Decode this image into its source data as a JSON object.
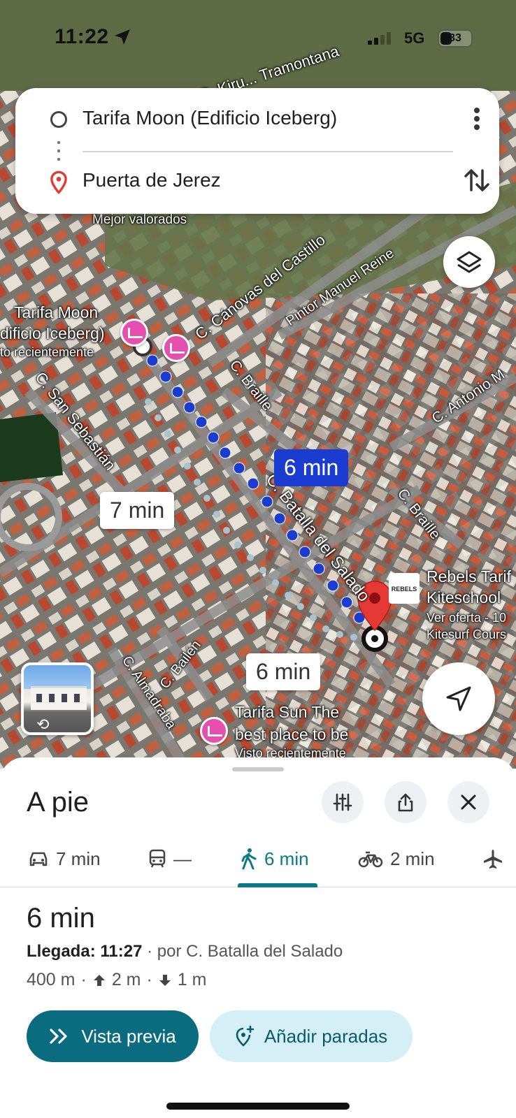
{
  "status": {
    "time": "11:22",
    "network": "5G",
    "battery": "33"
  },
  "search": {
    "origin": "Tarifa Moon (Edificio Iceberg)",
    "destination": "Puerta de Jerez"
  },
  "map": {
    "street_labels": {
      "tramontana": "C. Kiru... Tramontana",
      "canovas": "C. Cánovas del Castillo",
      "pintor": "Pintor Manuel Reine",
      "braille1": "C. Braille",
      "braille2": "C. Braille",
      "antonio": "C. Antonio M",
      "san_sebastian": "C. San Sebastián",
      "batalla": "C. Batalla del Salado",
      "bailen": "C. Bailén",
      "almadraba": "C. Almadraba"
    },
    "poi": {
      "mejor": "Mejor valorados",
      "moon_name1": "Tarifa Moon",
      "moon_name2": "dificio Iceberg)",
      "moon_sub": "to recientemente",
      "rebels1": "Rebels Tarif",
      "rebels2": "Kiteschool",
      "rebels3": "Ver oferta - 10",
      "rebels4": "Kitesurf Cours",
      "sun1": "Tarifa Sun The",
      "sun2": "best place to be",
      "sun3": "Visto recientemente",
      "rebels_logo": "REBELS"
    },
    "bubbles": {
      "alt_walk": "7 min",
      "walk_primary": "6 min",
      "alt_walk2": "6 min"
    },
    "colors": {
      "route_primary": "#1a3cd0",
      "route_alt": "#9fb8c4",
      "pin": "#e53935"
    }
  },
  "sheet": {
    "mode_title": "A pie",
    "tabs": [
      {
        "label": "7 min",
        "icon": "car-icon"
      },
      {
        "label": "—",
        "icon": "train-icon"
      },
      {
        "label": "6 min",
        "icon": "walk-icon"
      },
      {
        "label": "2 min",
        "icon": "bike-icon"
      },
      {
        "label": "",
        "icon": "plane-icon"
      }
    ],
    "route_time": "6 min",
    "arrival_label": "Llegada: 11:27",
    "arrival_via": " · por C. Batalla del Salado",
    "distance": "400 m",
    "ascent": "2 m",
    "descent": "1 m",
    "preview_button": "Vista previa",
    "add_stops_button": "Añadir paradas",
    "accent": "#0b7886"
  }
}
